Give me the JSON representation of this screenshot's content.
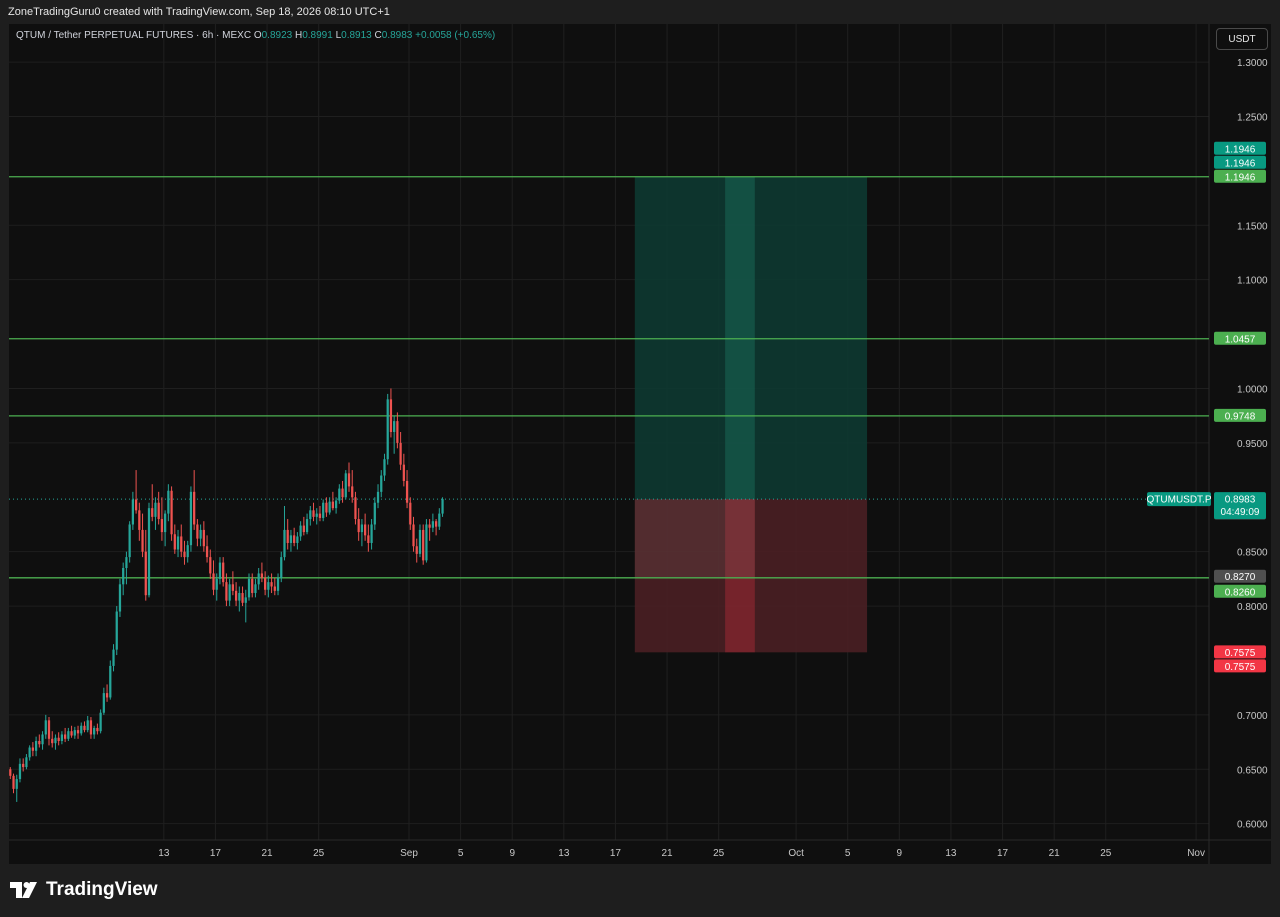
{
  "header": {
    "attribution": "ZoneTradingGuru0 created with TradingView.com, Sep 18, 2026 08:10 UTC+1"
  },
  "legend": {
    "symbol": "QTUM / Tether PERPETUAL FUTURES · 6h · MEXC",
    "open_label": "O",
    "open": "0.8923",
    "high_label": "H",
    "high": "0.8991",
    "low_label": "L",
    "low": "0.8913",
    "close_label": "C",
    "close": "0.8983",
    "change": "+0.0058 (+0.65%)"
  },
  "currency_button": "USDT",
  "footer": {
    "brand": "TradingView"
  },
  "colors": {
    "up": "#26a69a",
    "down": "#ef5350",
    "level": "#4caf50",
    "background": "#0f0f0f",
    "target_zone": "#0d3b33",
    "stop_zone": "#4a1f24"
  },
  "chart_data": {
    "type": "candlestick",
    "ylim": [
      0.585,
      1.335
    ],
    "y_ticks": [
      "1.3000",
      "1.2500",
      "1.1500",
      "1.1000",
      "1.0000",
      "0.9500",
      "0.8500",
      "0.8000",
      "0.7000",
      "0.6500",
      "0.6000"
    ],
    "y_tick_values": [
      1.3,
      1.25,
      1.15,
      1.1,
      1.0,
      0.95,
      0.85,
      0.8,
      0.7,
      0.65,
      0.6
    ],
    "x_ticks": [
      "13",
      "17",
      "21",
      "25",
      "Sep",
      "5",
      "9",
      "13",
      "17",
      "21",
      "25",
      "Oct",
      "5",
      "9",
      "13",
      "17",
      "21",
      "25",
      "Nov"
    ],
    "x_tick_days": [
      12,
      16,
      20,
      24,
      31,
      35,
      39,
      43,
      47,
      51,
      55,
      61,
      65,
      69,
      73,
      77,
      81,
      85,
      92
    ],
    "x_range_days": [
      0,
      93
    ],
    "x_axis_note": "days since Aug 1, 2026",
    "horizontal_levels": [
      1.1946,
      1.0457,
      0.9748,
      0.826
    ],
    "long_position": {
      "start_day": 48.5,
      "end_day": 66.5,
      "highlight_start_day": 55.5,
      "highlight_end_day": 57.8,
      "entry": 0.8983,
      "target": 1.1946,
      "stop": 0.7575,
      "entry_end_day": 57.8
    },
    "price_tags": [
      {
        "label": "1.1946",
        "value": 1.1946,
        "offset": -2,
        "color": "#089981"
      },
      {
        "label": "1.1946",
        "value": 1.1946,
        "offset": -1,
        "color": "#089981"
      },
      {
        "label": "1.1946",
        "value": 1.1946,
        "offset": 0,
        "color": "#4caf50"
      },
      {
        "label": "1.0457",
        "value": 1.0457,
        "offset": 0,
        "color": "#4caf50"
      },
      {
        "label": "0.9748",
        "value": 0.9748,
        "offset": 0,
        "color": "#4caf50"
      },
      {
        "label": "0.8980",
        "value": 0.898,
        "offset": 1,
        "color": "#4f4f4f"
      },
      {
        "label": "0.8270",
        "value": 0.827,
        "offset": 0,
        "color": "#4f4f4f"
      },
      {
        "label": "0.8260",
        "value": 0.826,
        "offset": 1,
        "color": "#4caf50"
      },
      {
        "label": "0.7575",
        "value": 0.7575,
        "offset": 0,
        "color": "#f23645"
      },
      {
        "label": "0.7575",
        "value": 0.7575,
        "offset": 1,
        "color": "#f23645"
      }
    ],
    "last_price": {
      "symbol_label": "QTUMUSDT.P",
      "price": "0.8983",
      "countdown": "04:49:09",
      "value": 0.8983
    },
    "candles": [
      [
        0.65,
        0.652,
        0.641,
        0.644
      ],
      [
        0.644,
        0.646,
        0.628,
        0.632
      ],
      [
        0.632,
        0.645,
        0.62,
        0.641
      ],
      [
        0.641,
        0.66,
        0.638,
        0.655
      ],
      [
        0.655,
        0.66,
        0.648,
        0.652
      ],
      [
        0.652,
        0.664,
        0.65,
        0.661
      ],
      [
        0.661,
        0.672,
        0.658,
        0.67
      ],
      [
        0.67,
        0.675,
        0.662,
        0.667
      ],
      [
        0.667,
        0.68,
        0.662,
        0.676
      ],
      [
        0.676,
        0.682,
        0.67,
        0.673
      ],
      [
        0.673,
        0.685,
        0.668,
        0.682
      ],
      [
        0.682,
        0.7,
        0.678,
        0.695
      ],
      [
        0.695,
        0.698,
        0.672,
        0.678
      ],
      [
        0.678,
        0.685,
        0.67,
        0.674
      ],
      [
        0.674,
        0.682,
        0.668,
        0.679
      ],
      [
        0.679,
        0.684,
        0.672,
        0.676
      ],
      [
        0.676,
        0.685,
        0.673,
        0.682
      ],
      [
        0.682,
        0.688,
        0.675,
        0.678
      ],
      [
        0.678,
        0.688,
        0.676,
        0.685
      ],
      [
        0.685,
        0.69,
        0.679,
        0.681
      ],
      [
        0.681,
        0.689,
        0.678,
        0.686
      ],
      [
        0.686,
        0.69,
        0.678,
        0.683
      ],
      [
        0.683,
        0.693,
        0.681,
        0.69
      ],
      [
        0.69,
        0.694,
        0.684,
        0.686
      ],
      [
        0.686,
        0.699,
        0.684,
        0.695
      ],
      [
        0.695,
        0.698,
        0.678,
        0.682
      ],
      [
        0.682,
        0.69,
        0.678,
        0.688
      ],
      [
        0.688,
        0.692,
        0.682,
        0.685
      ],
      [
        0.685,
        0.705,
        0.683,
        0.702
      ],
      [
        0.702,
        0.725,
        0.7,
        0.72
      ],
      [
        0.72,
        0.728,
        0.712,
        0.716
      ],
      [
        0.716,
        0.75,
        0.714,
        0.745
      ],
      [
        0.745,
        0.765,
        0.74,
        0.76
      ],
      [
        0.76,
        0.8,
        0.755,
        0.795
      ],
      [
        0.795,
        0.825,
        0.79,
        0.82
      ],
      [
        0.82,
        0.84,
        0.81,
        0.835
      ],
      [
        0.835,
        0.85,
        0.82,
        0.845
      ],
      [
        0.845,
        0.878,
        0.84,
        0.875
      ],
      [
        0.875,
        0.905,
        0.87,
        0.898
      ],
      [
        0.898,
        0.925,
        0.885,
        0.888
      ],
      [
        0.888,
        0.895,
        0.86,
        0.87
      ],
      [
        0.87,
        0.885,
        0.845,
        0.85
      ],
      [
        0.85,
        0.87,
        0.805,
        0.81
      ],
      [
        0.81,
        0.895,
        0.808,
        0.89
      ],
      [
        0.89,
        0.912,
        0.878,
        0.882
      ],
      [
        0.882,
        0.9,
        0.87,
        0.895
      ],
      [
        0.895,
        0.905,
        0.875,
        0.88
      ],
      [
        0.88,
        0.9,
        0.86,
        0.868
      ],
      [
        0.868,
        0.888,
        0.855,
        0.885
      ],
      [
        0.885,
        0.912,
        0.878,
        0.906
      ],
      [
        0.906,
        0.91,
        0.86,
        0.866
      ],
      [
        0.866,
        0.875,
        0.848,
        0.852
      ],
      [
        0.852,
        0.87,
        0.845,
        0.864
      ],
      [
        0.864,
        0.875,
        0.845,
        0.85
      ],
      [
        0.85,
        0.86,
        0.838,
        0.845
      ],
      [
        0.845,
        0.86,
        0.84,
        0.856
      ],
      [
        0.856,
        0.91,
        0.85,
        0.905
      ],
      [
        0.905,
        0.925,
        0.87,
        0.875
      ],
      [
        0.875,
        0.88,
        0.855,
        0.862
      ],
      [
        0.862,
        0.875,
        0.855,
        0.87
      ],
      [
        0.87,
        0.878,
        0.85,
        0.855
      ],
      [
        0.855,
        0.865,
        0.84,
        0.845
      ],
      [
        0.845,
        0.852,
        0.825,
        0.83
      ],
      [
        0.83,
        0.842,
        0.81,
        0.815
      ],
      [
        0.815,
        0.83,
        0.805,
        0.825
      ],
      [
        0.825,
        0.845,
        0.82,
        0.84
      ],
      [
        0.84,
        0.845,
        0.818,
        0.822
      ],
      [
        0.822,
        0.83,
        0.8,
        0.805
      ],
      [
        0.805,
        0.825,
        0.8,
        0.82
      ],
      [
        0.82,
        0.832,
        0.81,
        0.814
      ],
      [
        0.814,
        0.822,
        0.8,
        0.805
      ],
      [
        0.805,
        0.818,
        0.795,
        0.812
      ],
      [
        0.812,
        0.818,
        0.8,
        0.803
      ],
      [
        0.803,
        0.815,
        0.785,
        0.808
      ],
      [
        0.808,
        0.83,
        0.805,
        0.825
      ],
      [
        0.825,
        0.83,
        0.808,
        0.812
      ],
      [
        0.812,
        0.825,
        0.808,
        0.82
      ],
      [
        0.82,
        0.835,
        0.815,
        0.83
      ],
      [
        0.83,
        0.84,
        0.822,
        0.826
      ],
      [
        0.826,
        0.832,
        0.81,
        0.815
      ],
      [
        0.815,
        0.828,
        0.808,
        0.822
      ],
      [
        0.822,
        0.83,
        0.812,
        0.818
      ],
      [
        0.818,
        0.826,
        0.81,
        0.814
      ],
      [
        0.814,
        0.83,
        0.81,
        0.826
      ],
      [
        0.826,
        0.85,
        0.822,
        0.845
      ],
      [
        0.845,
        0.892,
        0.842,
        0.87
      ],
      [
        0.87,
        0.88,
        0.852,
        0.858
      ],
      [
        0.858,
        0.87,
        0.85,
        0.865
      ],
      [
        0.865,
        0.872,
        0.855,
        0.858
      ],
      [
        0.858,
        0.868,
        0.852,
        0.864
      ],
      [
        0.864,
        0.878,
        0.86,
        0.874
      ],
      [
        0.874,
        0.882,
        0.865,
        0.868
      ],
      [
        0.868,
        0.885,
        0.866,
        0.88
      ],
      [
        0.88,
        0.892,
        0.874,
        0.888
      ],
      [
        0.888,
        0.895,
        0.878,
        0.882
      ],
      [
        0.882,
        0.89,
        0.875,
        0.885
      ],
      [
        0.885,
        0.892,
        0.878,
        0.881
      ],
      [
        0.881,
        0.898,
        0.878,
        0.895
      ],
      [
        0.895,
        0.9,
        0.882,
        0.886
      ],
      [
        0.886,
        0.9,
        0.884,
        0.896
      ],
      [
        0.896,
        0.905,
        0.888,
        0.89
      ],
      [
        0.89,
        0.9,
        0.885,
        0.897
      ],
      [
        0.897,
        0.912,
        0.894,
        0.908
      ],
      [
        0.908,
        0.915,
        0.895,
        0.9
      ],
      [
        0.9,
        0.925,
        0.898,
        0.922
      ],
      [
        0.922,
        0.932,
        0.905,
        0.91
      ],
      [
        0.91,
        0.925,
        0.895,
        0.9
      ],
      [
        0.9,
        0.905,
        0.875,
        0.88
      ],
      [
        0.88,
        0.89,
        0.86,
        0.868
      ],
      [
        0.868,
        0.88,
        0.855,
        0.875
      ],
      [
        0.875,
        0.885,
        0.86,
        0.865
      ],
      [
        0.865,
        0.875,
        0.85,
        0.858
      ],
      [
        0.858,
        0.88,
        0.852,
        0.875
      ],
      [
        0.875,
        0.9,
        0.87,
        0.895
      ],
      [
        0.895,
        0.912,
        0.89,
        0.905
      ],
      [
        0.905,
        0.925,
        0.9,
        0.92
      ],
      [
        0.92,
        0.94,
        0.915,
        0.935
      ],
      [
        0.935,
        0.995,
        0.93,
        0.99
      ],
      [
        0.99,
        1.0,
        0.955,
        0.96
      ],
      [
        0.96,
        0.975,
        0.94,
        0.97
      ],
      [
        0.97,
        0.978,
        0.945,
        0.95
      ],
      [
        0.95,
        0.96,
        0.925,
        0.93
      ],
      [
        0.93,
        0.94,
        0.91,
        0.915
      ],
      [
        0.915,
        0.925,
        0.89,
        0.895
      ],
      [
        0.895,
        0.9,
        0.87,
        0.875
      ],
      [
        0.875,
        0.882,
        0.85,
        0.855
      ],
      [
        0.855,
        0.862,
        0.84,
        0.848
      ],
      [
        0.848,
        0.875,
        0.845,
        0.87
      ],
      [
        0.87,
        0.875,
        0.838,
        0.842
      ],
      [
        0.842,
        0.88,
        0.84,
        0.875
      ],
      [
        0.875,
        0.88,
        0.86,
        0.872
      ],
      [
        0.872,
        0.885,
        0.868,
        0.878
      ],
      [
        0.878,
        0.88,
        0.865,
        0.873
      ],
      [
        0.873,
        0.89,
        0.87,
        0.885
      ],
      [
        0.885,
        0.9,
        0.882,
        0.8983
      ]
    ],
    "candle_start_day": 0.1,
    "candle_step_days": 0.25
  }
}
